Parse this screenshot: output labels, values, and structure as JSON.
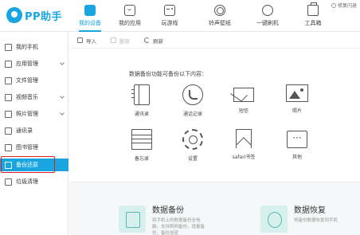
{
  "app": {
    "logo_text": "PP助手"
  },
  "nav": {
    "tabs": [
      {
        "label": "我的设备",
        "icon": "phone-icon"
      },
      {
        "label": "我的应用",
        "icon": "bag-icon"
      },
      {
        "label": "玩游戏",
        "icon": "gamepad-icon"
      },
      {
        "label": "铃声壁纸",
        "icon": "brush-icon"
      },
      {
        "label": "一键刷机",
        "icon": "power-icon"
      },
      {
        "label": "工具箱",
        "icon": "toolbox-icon"
      }
    ],
    "top_right_label": "修复闪退"
  },
  "sidebar": {
    "items": [
      {
        "label": "我的手机"
      },
      {
        "label": "应用管理"
      },
      {
        "label": "文件管理"
      },
      {
        "label": "视频音乐"
      },
      {
        "label": "照片管理"
      },
      {
        "label": "通讯录"
      },
      {
        "label": "图书管理"
      },
      {
        "label": "备份还原"
      },
      {
        "label": "垃圾清理"
      }
    ]
  },
  "toolbar": {
    "import_label": "导入",
    "delete_label": "删除",
    "refresh_label": "刷新"
  },
  "content": {
    "title": "数据备份功能可备份以下内容：",
    "items": [
      {
        "label": "通讯录",
        "icon": "contacts-icon"
      },
      {
        "label": "通话记录",
        "icon": "call-log-icon"
      },
      {
        "label": "短信",
        "icon": "sms-icon"
      },
      {
        "label": "照片",
        "icon": "photo-icon"
      },
      {
        "label": "备忘录",
        "icon": "memo-icon"
      },
      {
        "label": "设置",
        "icon": "settings-icon"
      },
      {
        "label": "safari书签",
        "icon": "bookmark-icon"
      },
      {
        "label": "其他",
        "icon": "other-icon"
      }
    ]
  },
  "bottom": {
    "backup": {
      "title": "数据备份",
      "desc": "将手机上的数据备份至电脑，支持断网备份，增量备份，备份加密"
    },
    "restore": {
      "title": "数据恢复",
      "desc": "将备份数据恢复到手机"
    }
  },
  "colors": {
    "accent": "#19a6e0",
    "highlight": "#e02020",
    "card_icon_bg": "#d6f0ee"
  }
}
